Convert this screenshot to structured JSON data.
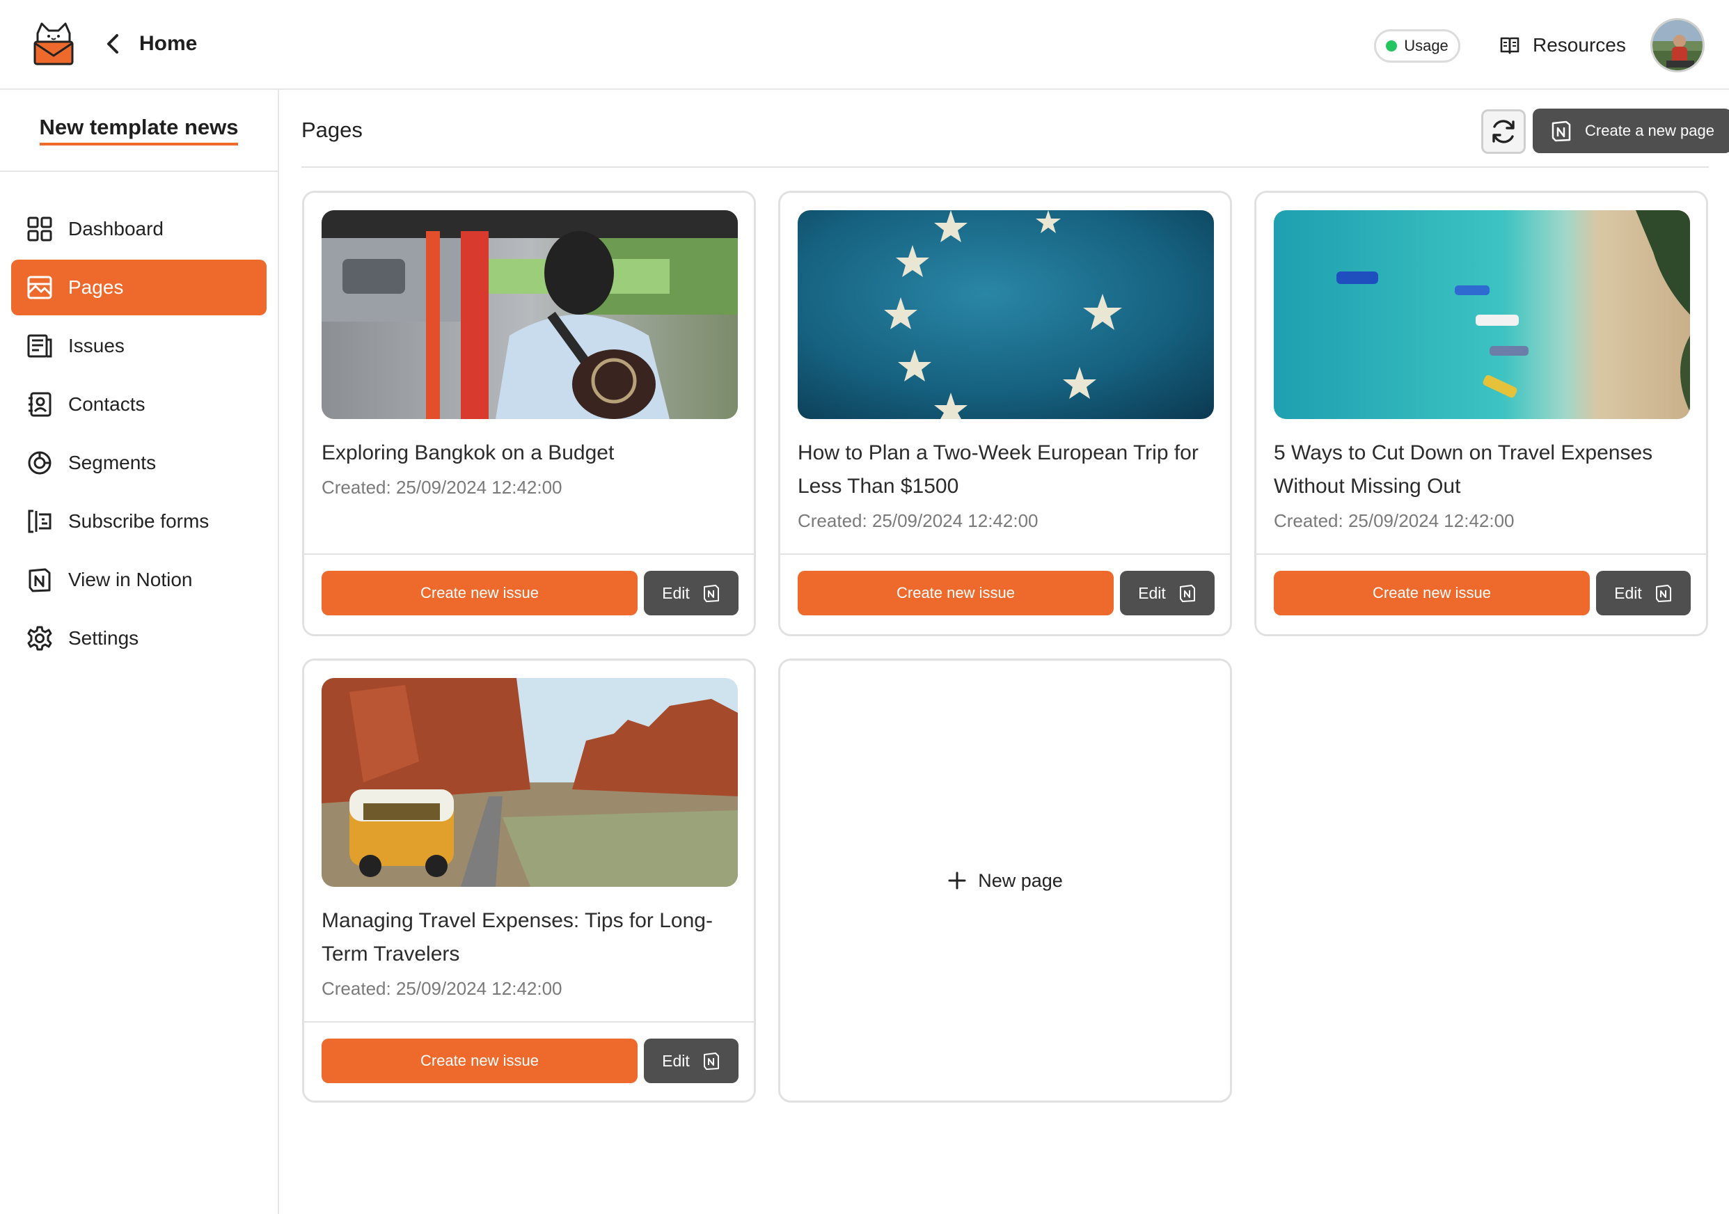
{
  "topbar": {
    "home_label": "Home",
    "usage_label": "Usage",
    "resources_label": "Resources"
  },
  "sidebar": {
    "project_name": "New template news",
    "items": [
      {
        "label": "Dashboard",
        "icon": "dashboard-icon"
      },
      {
        "label": "Pages",
        "icon": "image-icon",
        "active": true
      },
      {
        "label": "Issues",
        "icon": "newspaper-icon"
      },
      {
        "label": "Contacts",
        "icon": "contacts-icon"
      },
      {
        "label": "Segments",
        "icon": "segments-icon"
      },
      {
        "label": "Subscribe forms",
        "icon": "form-icon"
      },
      {
        "label": "View in Notion",
        "icon": "notion-icon"
      },
      {
        "label": "Settings",
        "icon": "gear-icon"
      }
    ]
  },
  "main": {
    "title": "Pages",
    "create_page_label": "Create a new page",
    "new_page_label": "New page",
    "cards": [
      {
        "title": "Exploring Bangkok on a Budget",
        "created": "Created: 25/09/2024 12:42:00",
        "image": "tuk-tuk ride photo",
        "create_issue_label": "Create new issue",
        "edit_label": "Edit"
      },
      {
        "title": "How to Plan a Two-Week European Trip for Less Than $1500",
        "created": "Created: 25/09/2024 12:42:00",
        "image": "EU flag photo",
        "create_issue_label": "Create new issue",
        "edit_label": "Edit"
      },
      {
        "title": "5 Ways to Cut Down on Travel Expenses Without Missing Out",
        "created": "Created: 25/09/2024 12:42:00",
        "image": "aerial beach boats photo",
        "create_issue_label": "Create new issue",
        "edit_label": "Edit"
      },
      {
        "title": "Managing Travel Expenses: Tips for Long-Term Travelers",
        "created": "Created: 25/09/2024 12:42:00",
        "image": "van in desert photo",
        "create_issue_label": "Create new issue",
        "edit_label": "Edit"
      }
    ]
  },
  "colors": {
    "accent": "#ee6a2c",
    "dark_button": "#4f4f4f",
    "usage_dot": "#22c55e"
  }
}
